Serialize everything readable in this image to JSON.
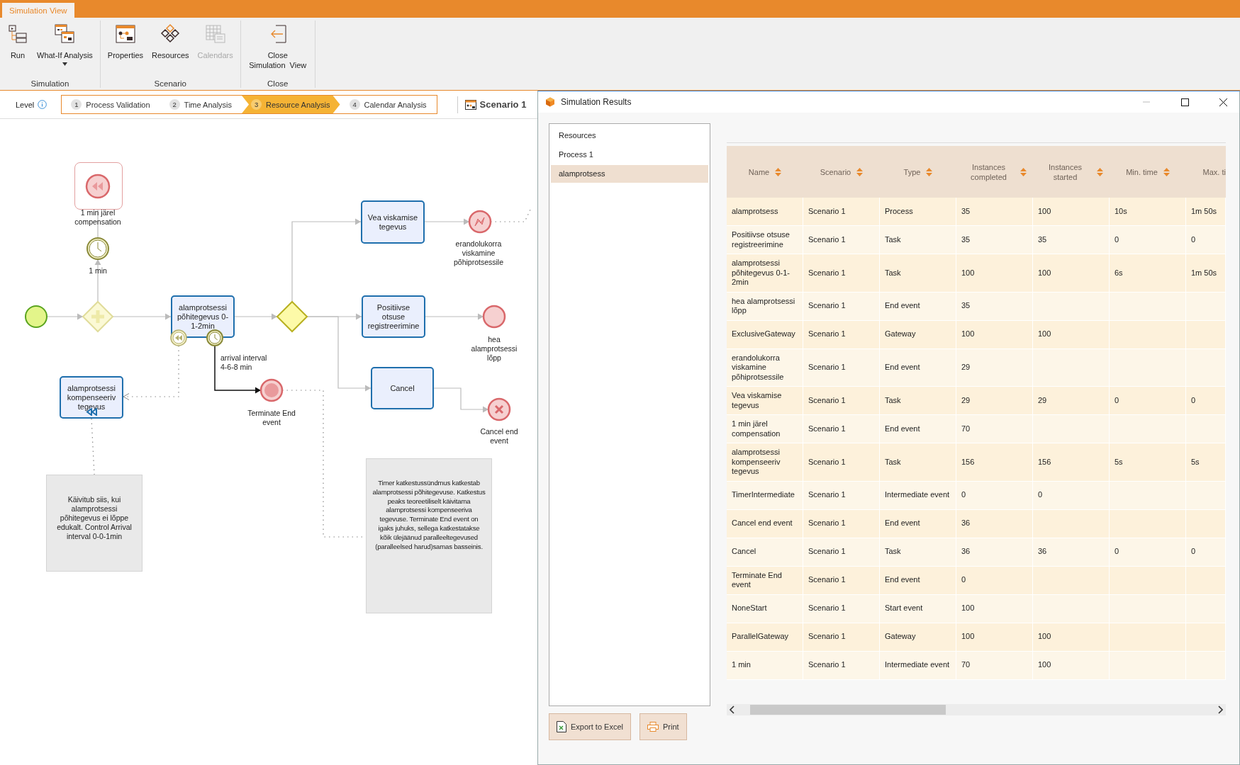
{
  "app_tab": "Simulation View",
  "ribbon": {
    "groups": [
      {
        "label": "Simulation",
        "buttons": [
          {
            "label": "Run",
            "disabled": false,
            "dropdown": false
          },
          {
            "label": "What-If Analysis",
            "disabled": false,
            "dropdown": true
          }
        ]
      },
      {
        "label": "Scenario",
        "buttons": [
          {
            "label": "Properties",
            "disabled": false,
            "dropdown": false
          },
          {
            "label": "Resources",
            "disabled": false,
            "dropdown": false
          },
          {
            "label": "Calendars",
            "disabled": true,
            "dropdown": false
          }
        ]
      },
      {
        "label": "Close",
        "buttons": [
          {
            "label": "Close Simulation View",
            "disabled": false,
            "dropdown": false
          }
        ]
      }
    ]
  },
  "level": {
    "label": "Level",
    "steps": [
      {
        "number": "1",
        "label": "Process Validation",
        "selected": false
      },
      {
        "number": "2",
        "label": "Time Analysis",
        "selected": false
      },
      {
        "number": "3",
        "label": "Resource Analysis",
        "selected": true
      },
      {
        "number": "4",
        "label": "Calendar Analysis",
        "selected": false
      }
    ]
  },
  "scenario": "Scenario 1",
  "diagram": {
    "nodes": [
      {
        "kind": "compensation_subprocess",
        "label": "1 min järel compensation"
      },
      {
        "kind": "timer_event",
        "label": "1 min"
      },
      {
        "kind": "start_event"
      },
      {
        "kind": "parallel_gateway"
      },
      {
        "kind": "task",
        "label": "alamprotsessi põhitegevus 0-1-2min"
      },
      {
        "kind": "boundary_compensation"
      },
      {
        "kind": "boundary_timer"
      },
      {
        "kind": "exclusive_gateway"
      },
      {
        "kind": "task",
        "label": "Vea viskamise tegevus"
      },
      {
        "kind": "error_end",
        "label": "erandolukorra viskamine põhiprotsessile"
      },
      {
        "kind": "task",
        "label": "Positiivse otsuse registreerimine"
      },
      {
        "kind": "end_event",
        "label": "hea alamprotsessi lõpp"
      },
      {
        "kind": "task",
        "label": "Cancel"
      },
      {
        "kind": "cancel_end",
        "label": "Cancel end event"
      },
      {
        "kind": "note_text",
        "label": "arrival interval 4-6-8 min"
      },
      {
        "kind": "terminate_end",
        "label": "Terminate End event"
      },
      {
        "kind": "compensation_task",
        "label": "alamprotsessi kompenseeriv tegevus"
      },
      {
        "kind": "annotation",
        "label": "Käivitub siis, kui alamprotsessi põhitegevus ei lõppe edukalt. Control Arrival interval  0-0-1min"
      },
      {
        "kind": "annotation",
        "label": "Timer katkestussündmus katkestab alamprotsessi põhitegevuse. Katkestus peaks teoreetiliselt käivitama alamprotsessi kompenseeriva tegevuse. Terminate End event on igaks juhuks, sellega katkestatakse kõik ülejäänud paralleeltegevused (paralleelsed harud)samas basseinis."
      }
    ]
  },
  "results": {
    "title": "Simulation Results",
    "list": [
      {
        "label": "Resources",
        "selected": false
      },
      {
        "label": "Process 1",
        "selected": false
      },
      {
        "label": "alamprotsess",
        "selected": true
      }
    ],
    "buttons": [
      "Export to Excel",
      "Print"
    ],
    "table": {
      "columns": [
        "Name",
        "Scenario",
        "Type",
        "Instances completed",
        "Instances started",
        "Min. time",
        "Max. ti"
      ],
      "rows": [
        [
          "alamprotsess",
          "Scenario 1",
          "Process",
          "35",
          "100",
          "10s",
          "1m 50s"
        ],
        [
          "Positiivse otsuse registreerimine",
          "Scenario 1",
          "Task",
          "35",
          "35",
          "0",
          "0"
        ],
        [
          "alamprotsessi põhitegevus 0-1-2min",
          "Scenario 1",
          "Task",
          "100",
          "100",
          "6s",
          "1m 50s"
        ],
        [
          "hea alamprotsessi lõpp",
          "Scenario 1",
          "End event",
          "35"
        ],
        [
          "ExclusiveGateway",
          "Scenario 1",
          "Gateway",
          "100",
          "100"
        ],
        [
          "erandolukorra viskamine põhiprotsessile",
          "Scenario 1",
          "End event",
          "29"
        ],
        [
          "Vea viskamise tegevus",
          "Scenario 1",
          "Task",
          "29",
          "29",
          "0",
          "0"
        ],
        [
          "1 min järel compensation",
          "Scenario 1",
          "End event",
          "70"
        ],
        [
          "alamprotsessi kompenseeriv tegevus",
          "Scenario 1",
          "Task",
          "156",
          "156",
          "5s",
          "5s"
        ],
        [
          "TimerIntermediate",
          "Scenario 1",
          "Intermediate event",
          "0",
          "0"
        ],
        [
          "Cancel end event",
          "Scenario 1",
          "End event",
          "36"
        ],
        [
          "Cancel",
          "Scenario 1",
          "Task",
          "36",
          "36",
          "0",
          "0"
        ],
        [
          "Terminate End event",
          "Scenario 1",
          "End event",
          "0"
        ],
        [
          "NoneStart",
          "Scenario 1",
          "Start event",
          "100"
        ],
        [
          "ParallelGateway",
          "Scenario 1",
          "Gateway",
          "100",
          "100"
        ],
        [
          "1 min",
          "Scenario 1",
          "Intermediate event",
          "70",
          "100"
        ]
      ]
    }
  }
}
